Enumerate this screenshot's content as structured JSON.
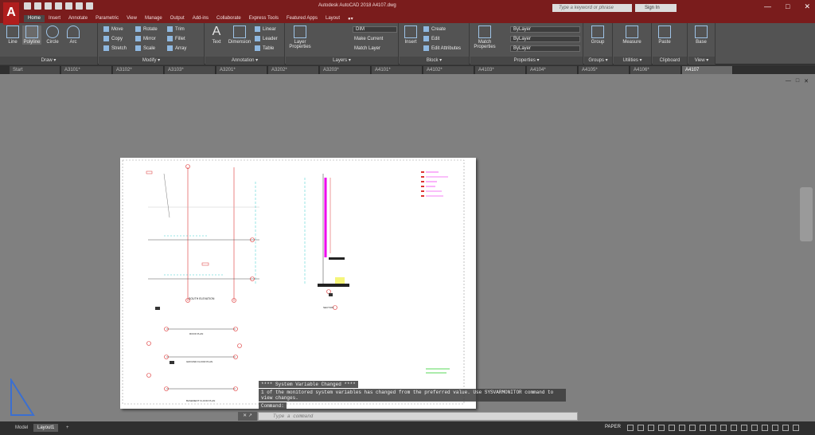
{
  "app": {
    "title": "Autodesk AutoCAD 2018   A4107.dwg",
    "search_placeholder": "Type a keyword or phrase",
    "sign_in": "Sign In",
    "logo": "A"
  },
  "ribbon_tabs": [
    "Home",
    "Insert",
    "Annotate",
    "Parametric",
    "View",
    "Manage",
    "Output",
    "Add-ins",
    "Collaborate",
    "Express Tools",
    "Featured Apps",
    "Layout",
    "●▾"
  ],
  "ribbon": {
    "draw": {
      "title": "Draw ▾",
      "line": "Line",
      "polyline": "Polyline",
      "circle": "Circle",
      "arc": "Arc"
    },
    "modify": {
      "title": "Modify ▾",
      "move": "Move",
      "rotate": "Rotate",
      "trim": "Trim",
      "copy": "Copy",
      "mirror": "Mirror",
      "fillet": "Fillet",
      "stretch": "Stretch",
      "scale": "Scale",
      "array": "Array"
    },
    "annotation": {
      "title": "Annotation ▾",
      "text": "Text",
      "dimension": "Dimension",
      "linear": "Linear",
      "leader": "Leader",
      "table": "Table"
    },
    "layers": {
      "title": "Layers ▾",
      "layer_properties": "Layer Properties",
      "layer_current": "DIM",
      "make_current": "Make Current",
      "match_layer": "Match Layer"
    },
    "block": {
      "title": "Block ▾",
      "insert": "Insert",
      "create": "Create",
      "edit": "Edit",
      "edit_attributes": "Edit Attributes"
    },
    "properties": {
      "title": "Properties ▾",
      "match_properties": "Match Properties",
      "color": "ByLayer",
      "linetype": "ByLayer",
      "lineweight": "ByLayer"
    },
    "groups": {
      "title": "Groups ▾",
      "group": "Group"
    },
    "utilities": {
      "title": "Utilities ▾",
      "measure": "Measure"
    },
    "clipboard": {
      "title": "Clipboard",
      "paste": "Paste"
    },
    "view": {
      "title": "View ▾",
      "base": "Base"
    }
  },
  "file_tabs": [
    "Start",
    "A3101*",
    "A3102*",
    "A3103*",
    "A3201*",
    "A3202*",
    "A3203*",
    "A4101*",
    "A4102*",
    "A4103*",
    "A4104*",
    "A4105*",
    "A4106*",
    "A4107"
  ],
  "command": {
    "lines": [
      "**** System Variable Changed ****",
      "1 of the monitored system variables has changed from the preferred value. Use SYSVARMONITOR command to view changes.",
      "Command:"
    ],
    "placeholder": "Type a command"
  },
  "layout_tabs": [
    "Model",
    "Layout1",
    "+"
  ],
  "status": {
    "space": "PAPER"
  },
  "drawing": {
    "labels": [
      "SOUTH ELEVATION",
      "ROOF PLAN",
      "GROUND FLOOR PLAN",
      "BASEMENT FLOOR PLAN",
      "SECTION"
    ]
  }
}
